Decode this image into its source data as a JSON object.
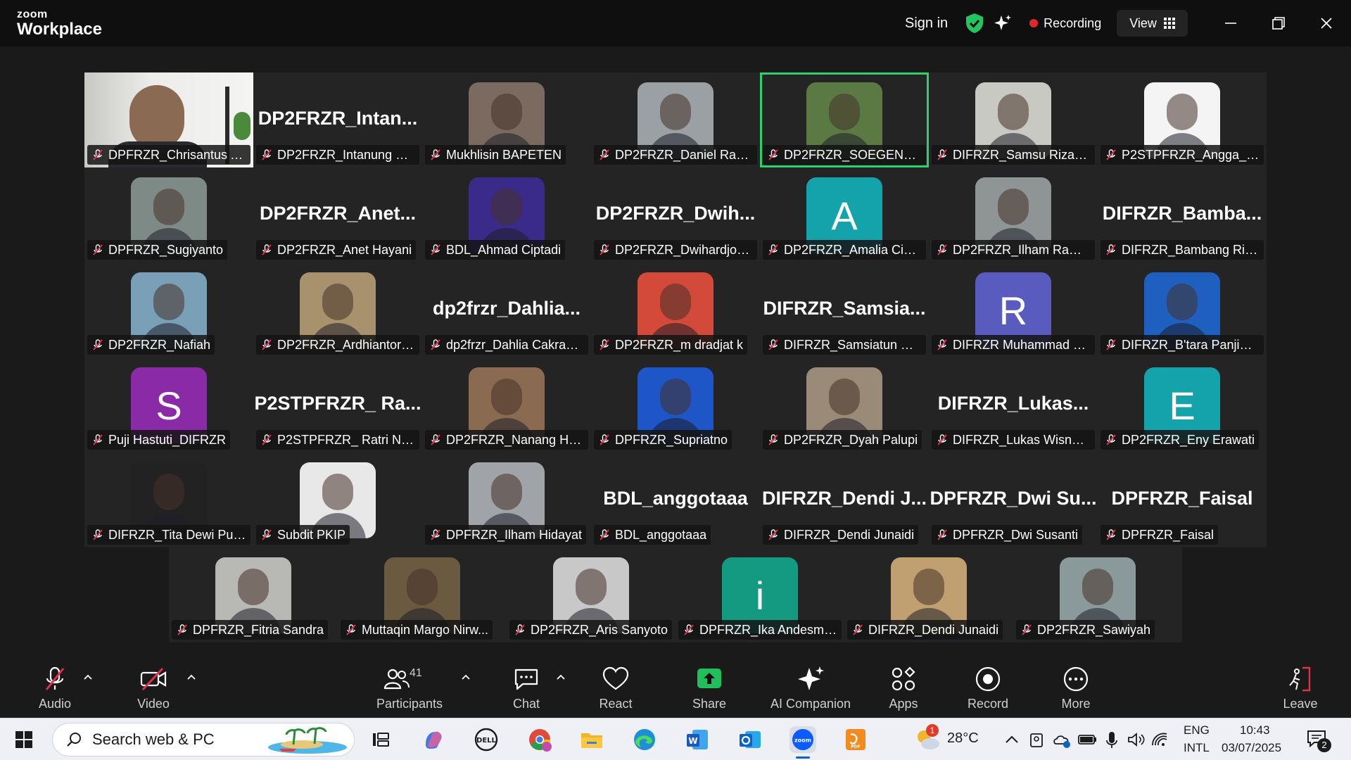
{
  "app": {
    "brand_top": "zoom",
    "brand_bottom": "Workplace"
  },
  "titlebar": {
    "sign_in": "Sign in",
    "recording": "Recording",
    "view": "View"
  },
  "participants": [
    {
      "name": "DPFRZR_Chrisantus Ar...",
      "kind": "video",
      "bg": "#d9d9d6"
    },
    {
      "name": "DP2FRZR_Intanung Sy...",
      "kind": "text",
      "big": "DP2FRZR_Intan..."
    },
    {
      "name": "Mukhlisin BAPETEN",
      "kind": "photo",
      "bg": "#7a6a60"
    },
    {
      "name": "DP2FRZR_Daniel Rawi...",
      "kind": "photo",
      "bg": "#9aa0a4"
    },
    {
      "name": "DP2FRZR_SOEGENG RAH...",
      "kind": "photo",
      "bg": "#5b7a43",
      "active": true
    },
    {
      "name": "DIFRZR_Samsu Riza Wi...",
      "kind": "photo",
      "bg": "#c9c9c4"
    },
    {
      "name": "P2STPFRZR_Angga_Ka...",
      "kind": "photo",
      "bg": "#f4f4f4"
    },
    {
      "name": "DPFRZR_Sugiyanto",
      "kind": "photo",
      "bg": "#7d8a86"
    },
    {
      "name": "DP2FRZR_Anet Hayani",
      "kind": "text",
      "big": "DP2FRZR_Anet..."
    },
    {
      "name": "BDL_Ahmad Ciptadi",
      "kind": "photo",
      "bg": "#3a2a8a"
    },
    {
      "name": "DP2FRZR_Dwihardjo R...",
      "kind": "text",
      "big": "DP2FRZR_Dwih..."
    },
    {
      "name": "DP2FRZR_Amalia Cipta...",
      "kind": "letter",
      "letter": "A",
      "bg": "#15a3ab"
    },
    {
      "name": "DP2FRZR_Ilham Rama...",
      "kind": "photo",
      "bg": "#8f9494"
    },
    {
      "name": "DIFRZR_Bambang Riyo...",
      "kind": "text",
      "big": "DIFRZR_Bamba..."
    },
    {
      "name": "DP2FRZR_Nafiah",
      "kind": "photo",
      "bg": "#7aa0b8"
    },
    {
      "name": "DP2FRZR_Ardhiantoro ...",
      "kind": "photo",
      "bg": "#a8926e"
    },
    {
      "name": "dp2frzr_Dahlia Cakraw...",
      "kind": "text",
      "big": "dp2frzr_Dahlia..."
    },
    {
      "name": "DP2FRZR_m dradjat k",
      "kind": "photo",
      "bg": "#d44a3a"
    },
    {
      "name": "DIFRZR_Samsiatun Mu...",
      "kind": "text",
      "big": "DIFRZR_Samsia..."
    },
    {
      "name": "DIFRZR Muhammad Ri...",
      "kind": "letter",
      "letter": "R",
      "bg": "#5a5bbf"
    },
    {
      "name": "DIFRZR_B'tara Panjiwe...",
      "kind": "photo",
      "bg": "#1e5fc0"
    },
    {
      "name": "Puji Hastuti_DIFRZR",
      "kind": "letter",
      "letter": "S",
      "bg": "#8a2aa6"
    },
    {
      "name": "P2STPFRZR_ Ratri Nur...",
      "kind": "text",
      "big": "P2STPFRZR_ Ra..."
    },
    {
      "name": "DP2FRZR_Nanang Her...",
      "kind": "photo",
      "bg": "#8a6a50"
    },
    {
      "name": "DPFRZR_Supriatno",
      "kind": "photo",
      "bg": "#1e56c8"
    },
    {
      "name": "DP2FRZR_Dyah Palupi",
      "kind": "photo",
      "bg": "#9a8a78"
    },
    {
      "name": "DIFRZR_Lukas Wisnu ...",
      "kind": "text",
      "big": "DIFRZR_Lukas..."
    },
    {
      "name": "DP2FRZR_Eny Erawati",
      "kind": "letter",
      "letter": "E",
      "bg": "#15a3ab"
    },
    {
      "name": "DIFRZR_Tita Dewi Pus...",
      "kind": "photo",
      "bg": "#222222"
    },
    {
      "name": "Subdit PKIP",
      "kind": "photo",
      "bg": "#e8e8e8"
    },
    {
      "name": "DPFRZR_Ilham Hidayat",
      "kind": "photo",
      "bg": "#a0a4a8"
    },
    {
      "name": "BDL_anggotaaa",
      "kind": "text",
      "big": "BDL_anggotaaa"
    },
    {
      "name": "DIFRZR_Dendi Junaidi",
      "kind": "text",
      "big": "DIFRZR_Dendi J..."
    },
    {
      "name": "DPFRZR_Dwi Susanti",
      "kind": "text",
      "big": "DPFRZR_Dwi Su..."
    },
    {
      "name": "DPFRZR_Faisal",
      "kind": "text",
      "big": "DPFRZR_Faisal"
    },
    {
      "name": "DPFRZR_Fitria Sandra",
      "kind": "photo",
      "bg": "#b8b8b4"
    },
    {
      "name": "Muttaqin Margo Nirw...",
      "kind": "photo",
      "bg": "#6a5a40"
    },
    {
      "name": "DP2FRZR_Aris Sanyoto",
      "kind": "photo",
      "bg": "#c8c8c8"
    },
    {
      "name": "DPFRZR_Ika Andesma...",
      "kind": "letter",
      "letter": "i",
      "bg": "#139a80"
    },
    {
      "name": "DIFRZR_Dendi Junaidi",
      "kind": "photo",
      "bg": "#c0a070"
    },
    {
      "name": "DP2FRZR_Sawiyah",
      "kind": "photo",
      "bg": "#8a9a9a"
    }
  ],
  "toolbar": {
    "audio": "Audio",
    "video": "Video",
    "participants": "Participants",
    "participant_count": "41",
    "chat": "Chat",
    "react": "React",
    "share": "Share",
    "ai_companion": "AI Companion",
    "apps": "Apps",
    "record": "Record",
    "more": "More",
    "leave": "Leave"
  },
  "taskbar": {
    "search_placeholder": "Search web & PC",
    "weather": "28°C",
    "lang": "ENG",
    "layout": "INTL",
    "time": "10:43",
    "date": "03/07/2025",
    "notif_count": "2",
    "outlook_badge": "1"
  },
  "colors": {
    "accent_green": "#2ad26b",
    "share_green": "#1fc05a",
    "record_red": "#e02828",
    "muted_red": "#e0314b"
  }
}
